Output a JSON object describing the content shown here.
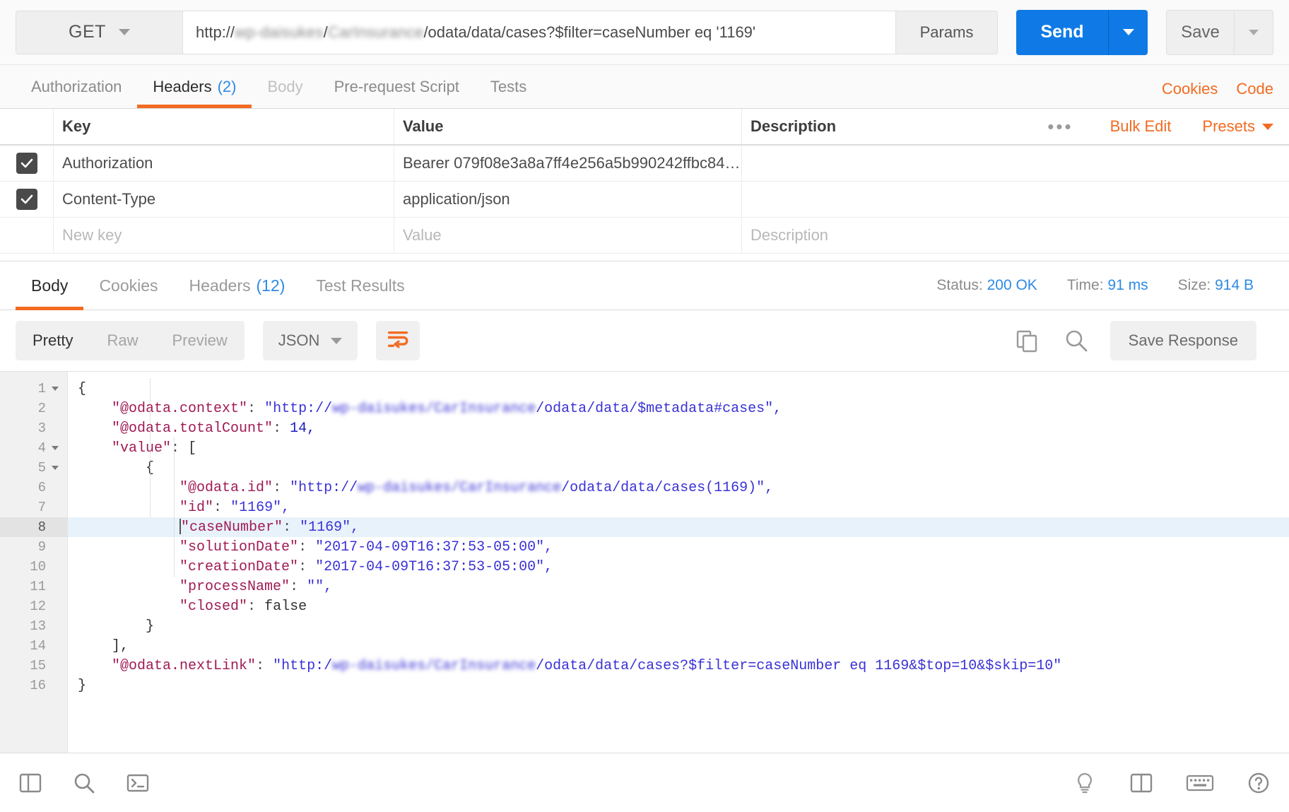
{
  "request": {
    "method": "GET",
    "url_prefix": "http://",
    "url_blur_host": "wp-daisukes",
    "url_sep1": "/",
    "url_blur_app": "CarInsurance",
    "url_suffix": "/odata/data/cases?$filter=caseNumber eq '1169'",
    "params_label": "Params",
    "send_label": "Send",
    "save_label": "Save"
  },
  "request_tabs": [
    {
      "label": "Authorization",
      "count": "",
      "active": false,
      "dim": false
    },
    {
      "label": "Headers",
      "count": "(2)",
      "active": true,
      "dim": false
    },
    {
      "label": "Body",
      "count": "",
      "active": false,
      "dim": true
    },
    {
      "label": "Pre-request Script",
      "count": "",
      "active": false,
      "dim": false
    },
    {
      "label": "Tests",
      "count": "",
      "active": false,
      "dim": false
    }
  ],
  "request_links": {
    "cookies": "Cookies",
    "code": "Code"
  },
  "headers_table": {
    "columns": {
      "key": "Key",
      "value": "Value",
      "description": "Description"
    },
    "tools": {
      "dots": "•••",
      "bulk_edit": "Bulk Edit",
      "presets": "Presets"
    },
    "rows": [
      {
        "checked": true,
        "key": "Authorization",
        "value": "Bearer 079f08e3a8a7ff4e256a5b990242ffbc84…",
        "description": ""
      },
      {
        "checked": true,
        "key": "Content-Type",
        "value": "application/json",
        "description": ""
      }
    ],
    "new_row": {
      "key_placeholder": "New key",
      "value_placeholder": "Value",
      "desc_placeholder": "Description"
    }
  },
  "response_tabs": [
    {
      "label": "Body",
      "count": "",
      "active": true
    },
    {
      "label": "Cookies",
      "count": "",
      "active": false
    },
    {
      "label": "Headers",
      "count": "(12)",
      "active": false
    },
    {
      "label": "Test Results",
      "count": "",
      "active": false
    }
  ],
  "response_status": {
    "status_label": "Status:",
    "status_value": "200 OK",
    "time_label": "Time:",
    "time_value": "91 ms",
    "size_label": "Size:",
    "size_value": "914 B"
  },
  "body_toolbar": {
    "pretty": "Pretty",
    "raw": "Raw",
    "preview": "Preview",
    "format": "JSON",
    "wrap_icon": "word-wrap-icon",
    "copy_icon": "copy-icon",
    "search_icon": "search-icon",
    "save_response": "Save Response"
  },
  "code": {
    "blur_host": "wp-daisukes/CarInsurance",
    "lines": [
      {
        "n": "1",
        "fold": true,
        "current": false
      },
      {
        "n": "2",
        "fold": false,
        "current": false
      },
      {
        "n": "3",
        "fold": false,
        "current": false
      },
      {
        "n": "4",
        "fold": true,
        "current": false
      },
      {
        "n": "5",
        "fold": true,
        "current": false
      },
      {
        "n": "6",
        "fold": false,
        "current": false
      },
      {
        "n": "7",
        "fold": false,
        "current": false
      },
      {
        "n": "8",
        "fold": false,
        "current": true
      },
      {
        "n": "9",
        "fold": false,
        "current": false
      },
      {
        "n": "10",
        "fold": false,
        "current": false
      },
      {
        "n": "11",
        "fold": false,
        "current": false
      },
      {
        "n": "12",
        "fold": false,
        "current": false
      },
      {
        "n": "13",
        "fold": false,
        "current": false
      },
      {
        "n": "14",
        "fold": false,
        "current": false
      },
      {
        "n": "15",
        "fold": false,
        "current": false
      },
      {
        "n": "16",
        "fold": false,
        "current": false
      }
    ],
    "text": {
      "l1": "{",
      "l2_key": "\"@odata.context\"",
      "l2_val_pre": "\"http://",
      "l2_val_post": "/odata/data/$metadata#cases\",",
      "l3_key": "\"@odata.totalCount\"",
      "l3_val": "14,",
      "l4_key": "\"value\"",
      "l4_val": "[",
      "l5": "{",
      "l6_key": "\"@odata.id\"",
      "l6_val_pre": "\"http://",
      "l6_val_post": "/odata/data/cases(1169)\",",
      "l7_key": "\"id\"",
      "l7_val": "\"1169\",",
      "l8_key": "\"caseNumber\"",
      "l8_val": "\"1169\",",
      "l9_key": "\"solutionDate\"",
      "l9_val": "\"2017-04-09T16:37:53-05:00\",",
      "l10_key": "\"creationDate\"",
      "l10_val": "\"2017-04-09T16:37:53-05:00\",",
      "l11_key": "\"processName\"",
      "l11_val": "\"\",",
      "l12_key": "\"closed\"",
      "l12_val": "false",
      "l13": "}",
      "l14": "],",
      "l15_key": "\"@odata.nextLink\"",
      "l15_val_pre": "\"http:/",
      "l15_val_post": "/odata/data/cases?$filter=caseNumber eq 1169&$top=10&$skip=10\"",
      "l16": "}"
    }
  },
  "bottom_bar": {
    "sidebar_toggle_icon": "sidebar-toggle-icon",
    "find_icon": "search-icon",
    "console_icon": "console-icon",
    "bulb_icon": "lightbulb-icon",
    "two_pane_icon": "two-pane-layout-icon",
    "keyboard_icon": "keyboard-icon",
    "help_icon": "help-icon"
  },
  "colors": {
    "accent_orange": "#f26b21",
    "accent_blue": "#2e8ae6",
    "send_blue": "#0f7ae5",
    "json_key": "#a01b54",
    "json_string": "#3a32d6",
    "json_number": "#1d1dbd"
  }
}
